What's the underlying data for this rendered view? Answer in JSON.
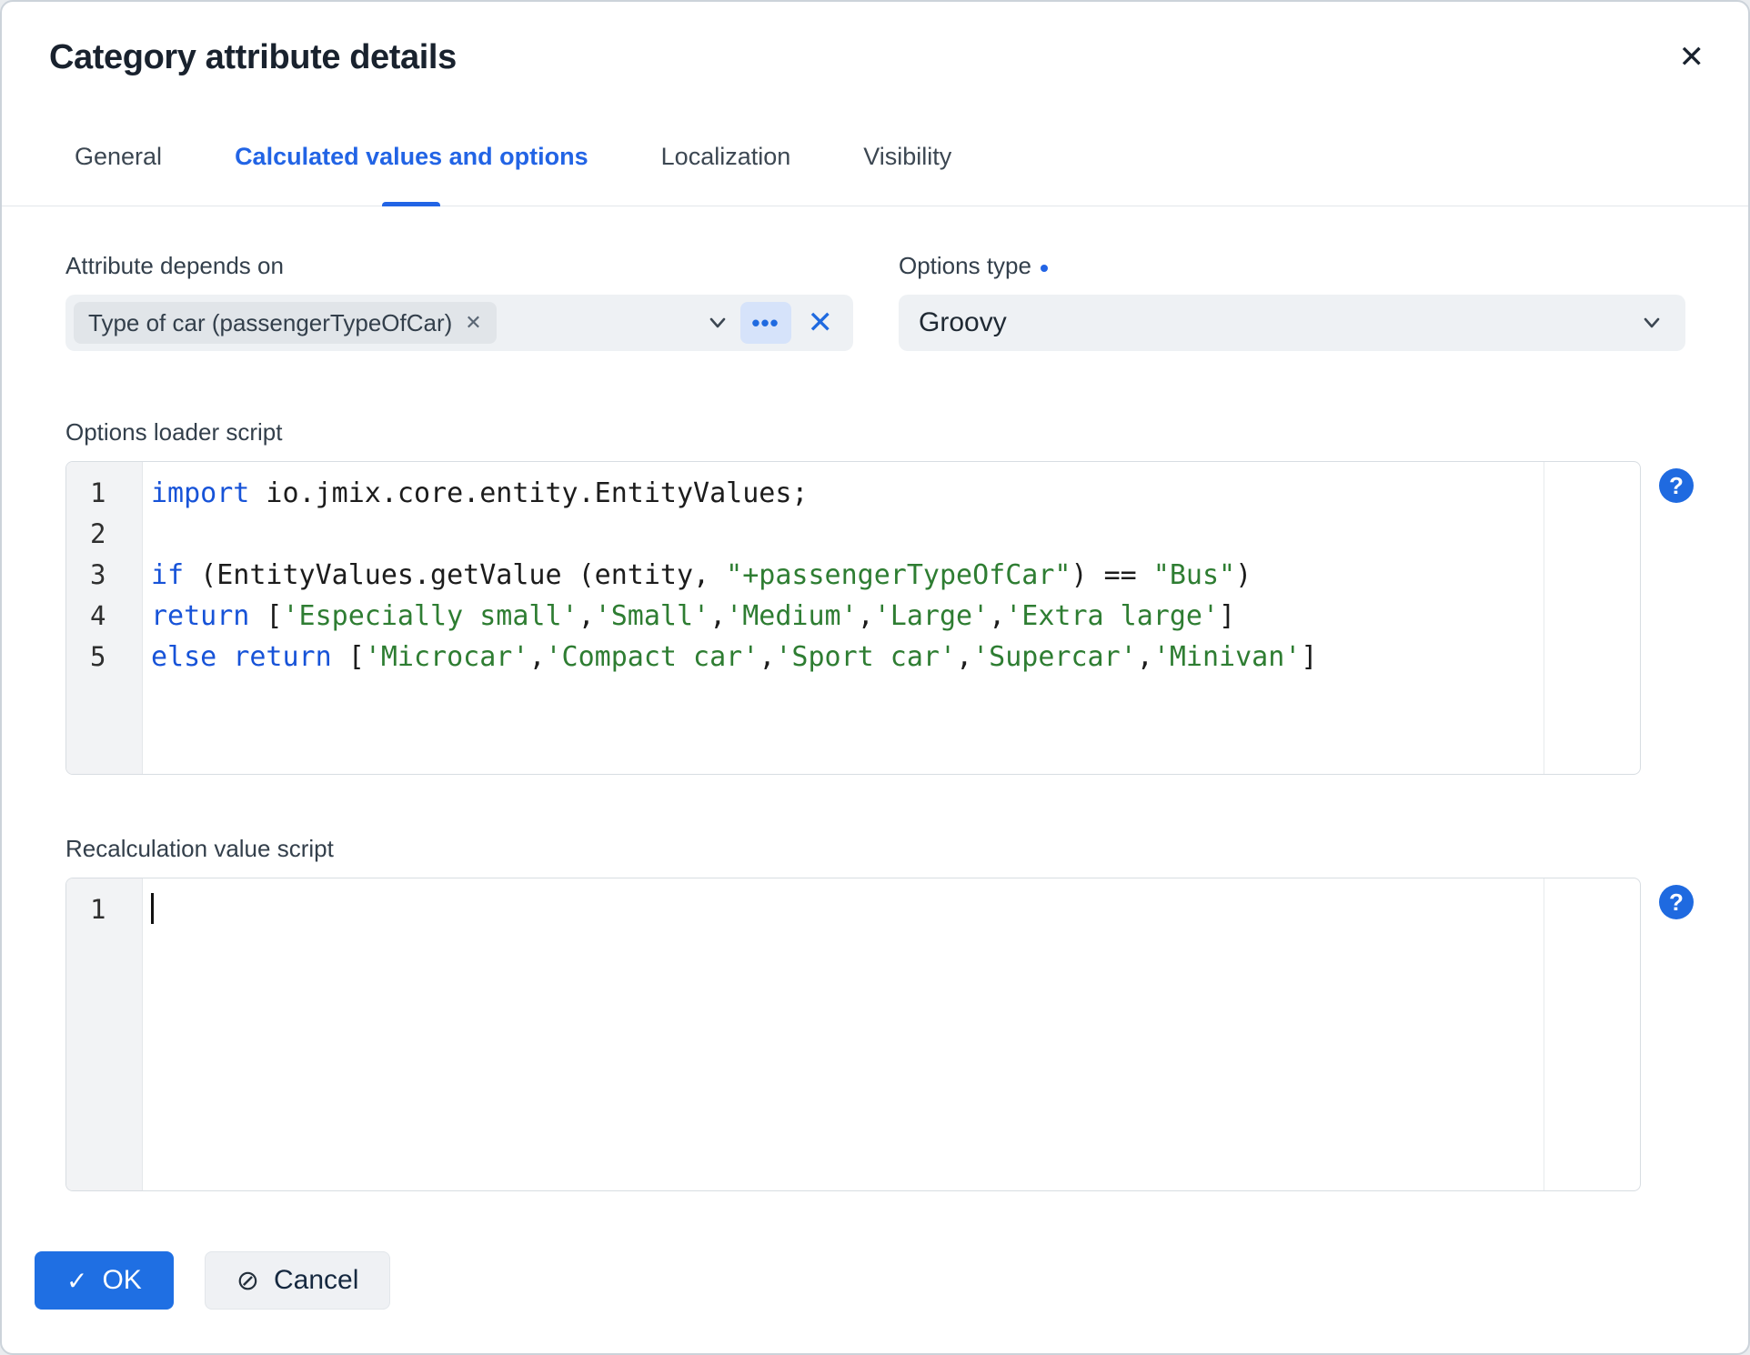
{
  "dialog": {
    "title": "Category attribute details"
  },
  "tabs": {
    "active_index": 1,
    "items": [
      {
        "label": "General"
      },
      {
        "label": "Calculated values and options"
      },
      {
        "label": "Localization"
      },
      {
        "label": "Visibility"
      }
    ]
  },
  "attribute_depends_on": {
    "label": "Attribute depends on",
    "selected_chip": "Type of car (passengerTypeOfCar)"
  },
  "options_type": {
    "label": "Options type",
    "value": "Groovy"
  },
  "options_loader": {
    "label": "Options loader script"
  },
  "recalculation": {
    "label": "Recalculation value script"
  },
  "code_editors": {
    "options_loader": {
      "show_cursor": false,
      "lines": [
        [
          [
            "kw",
            "import"
          ],
          [
            "pl",
            " io.jmix.core.entity.EntityValues;"
          ]
        ],
        [],
        [
          [
            "kw",
            "if"
          ],
          [
            "pl",
            " (EntityValues.getValue (entity, "
          ],
          [
            "str",
            "\"+passengerTypeOfCar\""
          ],
          [
            "pl",
            ") == "
          ],
          [
            "str",
            "\"Bus\""
          ],
          [
            "pl",
            ")"
          ]
        ],
        [
          [
            "kw",
            "return"
          ],
          [
            "pl",
            " ["
          ],
          [
            "str",
            "'Especially small'"
          ],
          [
            "pl",
            ","
          ],
          [
            "str",
            "'Small'"
          ],
          [
            "pl",
            ","
          ],
          [
            "str",
            "'Medium'"
          ],
          [
            "pl",
            ","
          ],
          [
            "str",
            "'Large'"
          ],
          [
            "pl",
            ","
          ],
          [
            "str",
            "'Extra large'"
          ],
          [
            "pl",
            "]"
          ]
        ],
        [
          [
            "kw",
            "else"
          ],
          [
            "pl",
            " "
          ],
          [
            "kw",
            "return"
          ],
          [
            "pl",
            " ["
          ],
          [
            "str",
            "'Microcar'"
          ],
          [
            "pl",
            ","
          ],
          [
            "str",
            "'Compact car'"
          ],
          [
            "pl",
            ","
          ],
          [
            "str",
            "'Sport car'"
          ],
          [
            "pl",
            ","
          ],
          [
            "str",
            "'Supercar'"
          ],
          [
            "pl",
            ","
          ],
          [
            "str",
            "'Minivan'"
          ],
          [
            "pl",
            "]"
          ]
        ]
      ]
    },
    "recalculation": {
      "show_cursor": true,
      "lines": [
        []
      ]
    }
  },
  "buttons": {
    "ok": "OK",
    "cancel": "Cancel"
  },
  "icons": {
    "close_dialog": "✕",
    "chip_remove": "✕",
    "ellipsis": "•••",
    "clear": "✕",
    "help": "?",
    "check": "✓",
    "ban": "⊘"
  },
  "colors": {
    "accent_blue": "#1f6ae0",
    "active_tab": "#2264e5",
    "keyword": "#1753d8",
    "string": "#2e7d32",
    "field_bg": "#eef1f4"
  }
}
